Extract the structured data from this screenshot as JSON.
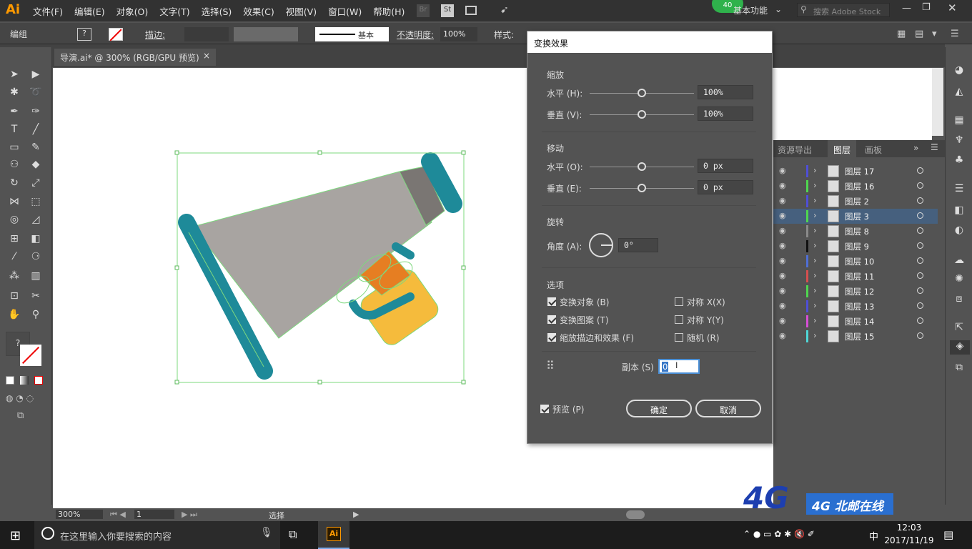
{
  "app": {
    "logo": "Ai"
  },
  "menu": [
    "文件(F)",
    "编辑(E)",
    "对象(O)",
    "文字(T)",
    "选择(S)",
    "效果(C)",
    "视图(V)",
    "窗口(W)",
    "帮助(H)"
  ],
  "topbar": {
    "badge": "40",
    "workspace": "基本功能",
    "search_placeholder": "搜索 Adobe Stock",
    "bridge": "Br",
    "stock": "St"
  },
  "control_bar": {
    "group_label": "编组",
    "stroke_label": "描边:",
    "stroke_style": "基本",
    "opacity_label": "不透明度:",
    "opacity_value": "100%",
    "style_label": "样式:",
    "fill_swatch": "?"
  },
  "document": {
    "tab_title": "导演.ai* @ 300% (RGB/GPU 预览)",
    "close": "×"
  },
  "status": {
    "zoom": "300%",
    "artboard": "1",
    "tool": "选择"
  },
  "dialog": {
    "title": "变换效果",
    "scale_section": "缩放",
    "scale_h_label": "水平 (H):",
    "scale_h_value": "100%",
    "scale_v_label": "垂直 (V):",
    "scale_v_value": "100%",
    "move_section": "移动",
    "move_h_label": "水平 (O):",
    "move_h_value": "0 px",
    "move_v_label": "垂直 (E):",
    "move_v_value": "0 px",
    "rotate_section": "旋转",
    "angle_label": "角度 (A):",
    "angle_value": "0°",
    "options_section": "选项",
    "opt_transform_objects": "变换对象 (B)",
    "opt_transform_patterns": "变换图案 (T)",
    "opt_scale_strokes": "缩放描边和效果 (F)",
    "opt_reflect_x": "对称 X(X)",
    "opt_reflect_y": "对称 Y(Y)",
    "opt_random": "随机 (R)",
    "copies_label": "副本 (S)",
    "copies_value": "0",
    "preview_label": "预览 (P)",
    "ok": "确定",
    "cancel": "取消"
  },
  "layers_panel": {
    "tabs": [
      "资源导出",
      "图层",
      "画板"
    ],
    "layers": [
      {
        "name": "图层 17",
        "color": "#4f4fd6"
      },
      {
        "name": "图层 16",
        "color": "#4fd64f"
      },
      {
        "name": "图层 2",
        "color": "#4f4fd6"
      },
      {
        "name": "图层 3",
        "color": "#4fd64f",
        "selected": true
      },
      {
        "name": "图层 8",
        "color": "#8a8a8a"
      },
      {
        "name": "图层 9",
        "color": "#111111"
      },
      {
        "name": "图层 10",
        "color": "#4f6fd6"
      },
      {
        "name": "图层 11",
        "color": "#d64f4f"
      },
      {
        "name": "图层 12",
        "color": "#4fd64f"
      },
      {
        "name": "图层 13",
        "color": "#4f4fd6"
      },
      {
        "name": "图层 14",
        "color": "#d64fd6"
      },
      {
        "name": "图层 15",
        "color": "#4fd6d6"
      }
    ]
  },
  "taskbar": {
    "search_placeholder": "在这里输入你要搜索的内容",
    "time": "12:03",
    "date": "2017/11/19",
    "ime": "中",
    "app": "Ai"
  },
  "watermark": {
    "text": "4G 北邮在线"
  },
  "colors": {
    "accent": "#ff9a00",
    "selection": "#46607e",
    "artwork_teal": "#1e8a99",
    "artwork_gray": "#a8a4a1",
    "artwork_orange": "#f5bb3c"
  }
}
